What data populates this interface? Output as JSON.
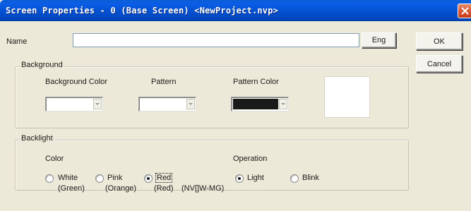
{
  "window": {
    "title": "Screen Properties - 0 (Base Screen) <NewProject.nvp>"
  },
  "name_row": {
    "label": "Name",
    "value": "",
    "eng_button": "Eng"
  },
  "buttons": {
    "ok": "OK",
    "cancel": "Cancel"
  },
  "background": {
    "group_title": "Background",
    "background_color_label": "Background Color",
    "pattern_label": "Pattern",
    "pattern_color_label": "Pattern Color",
    "background_color_value": "#ffffff",
    "pattern_value": "#ffffff",
    "pattern_color_value": "#1a1a1a",
    "preview_color": "#ffffff"
  },
  "backlight": {
    "group_title": "Backlight",
    "color_label": "Color",
    "operation_label": "Operation",
    "color_options": [
      {
        "line1": "White",
        "line2": "(Green)",
        "selected": false
      },
      {
        "line1": "Pink",
        "line2": "(Orange)",
        "selected": false
      },
      {
        "line1": "Red",
        "line2": "(Red)",
        "selected": true
      }
    ],
    "model_note": "(NV[]W-MG)",
    "operation_options": [
      {
        "label": "Light",
        "selected": true
      },
      {
        "label": "Blink",
        "selected": false
      }
    ]
  }
}
